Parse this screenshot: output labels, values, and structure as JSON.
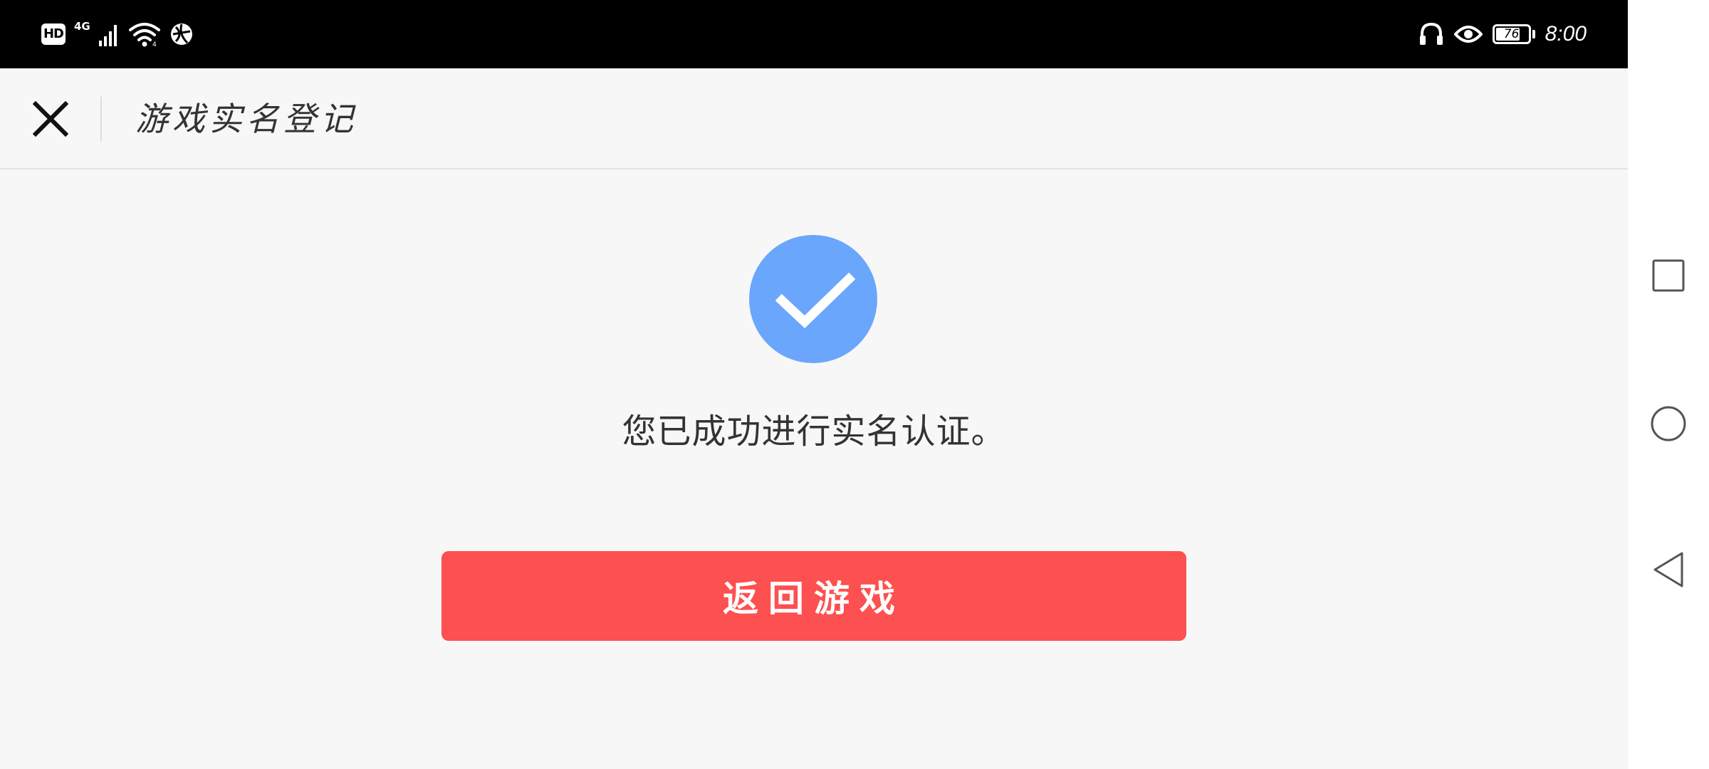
{
  "status_bar": {
    "hd_label": "HD",
    "network_type": "4G",
    "battery_level": "76",
    "battery_fraction": 0.76,
    "time": "8:00",
    "icons": [
      "signal-icon",
      "wifi-icon",
      "vpn-icon",
      "headphones-icon",
      "eye-icon",
      "battery-icon"
    ]
  },
  "header": {
    "title": "游戏实名登记",
    "close_icon": "close-icon"
  },
  "main": {
    "success_icon": "check-circle-icon",
    "success_color": "#6aa6fb",
    "message": "您已成功进行实名认证。",
    "return_button_label": "返回游戏",
    "button_color": "#fd5050"
  },
  "nav_bar": {
    "icons": [
      "recent-apps-icon",
      "home-icon",
      "back-icon"
    ]
  }
}
